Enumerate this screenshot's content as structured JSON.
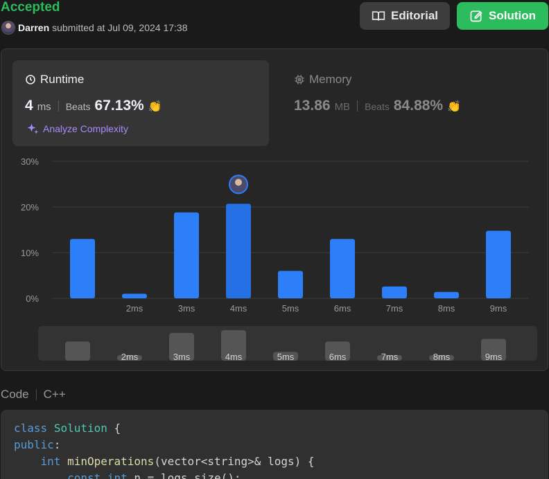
{
  "status": "Accepted",
  "submitter": {
    "name": "Darren",
    "text": "submitted at Jul 09, 2024 17:38"
  },
  "buttons": {
    "editorial": "Editorial",
    "solution": "Solution"
  },
  "runtime": {
    "title": "Runtime",
    "value": "4",
    "unit": "ms",
    "beats_label": "Beats",
    "beats": "67.13%",
    "analyze": "Analyze Complexity"
  },
  "memory": {
    "title": "Memory",
    "value": "13.86",
    "unit": "MB",
    "beats_label": "Beats",
    "beats": "84.88%"
  },
  "colors": {
    "accent_green": "#2cbb5d",
    "bar_blue": "#2d7ff9",
    "bar_selected": "#2670e6",
    "analyze_purple": "#a78bfa"
  },
  "chart_data": {
    "type": "bar",
    "categories": [
      "",
      "2ms",
      "3ms",
      "4ms",
      "5ms",
      "6ms",
      "7ms",
      "8ms",
      "9ms"
    ],
    "values": [
      13,
      1,
      18.8,
      20.7,
      6,
      13,
      2.6,
      1.4,
      14.8
    ],
    "selected_index": 3,
    "yticks": [
      "30%",
      "20%",
      "10%",
      "0%"
    ],
    "ylim": [
      0,
      30
    ],
    "grid": true
  },
  "code": {
    "label": "Code",
    "language": "C++",
    "lines": [
      [
        [
          "kw",
          "class"
        ],
        [
          "pl",
          " "
        ],
        [
          "ty",
          "Solution"
        ],
        [
          "pl",
          " {"
        ]
      ],
      [
        [
          "kw",
          "public"
        ],
        [
          "pl",
          ":"
        ]
      ],
      [
        [
          "pl",
          "    "
        ],
        [
          "kw",
          "int"
        ],
        [
          "pl",
          " "
        ],
        [
          "fn",
          "minOperations"
        ],
        [
          "pl",
          "(vector<string>& logs) {"
        ]
      ],
      [
        [
          "pl",
          "        "
        ],
        [
          "kw",
          "const"
        ],
        [
          "pl",
          " "
        ],
        [
          "kw",
          "int"
        ],
        [
          "pl",
          " n = logs.size();"
        ]
      ]
    ]
  }
}
